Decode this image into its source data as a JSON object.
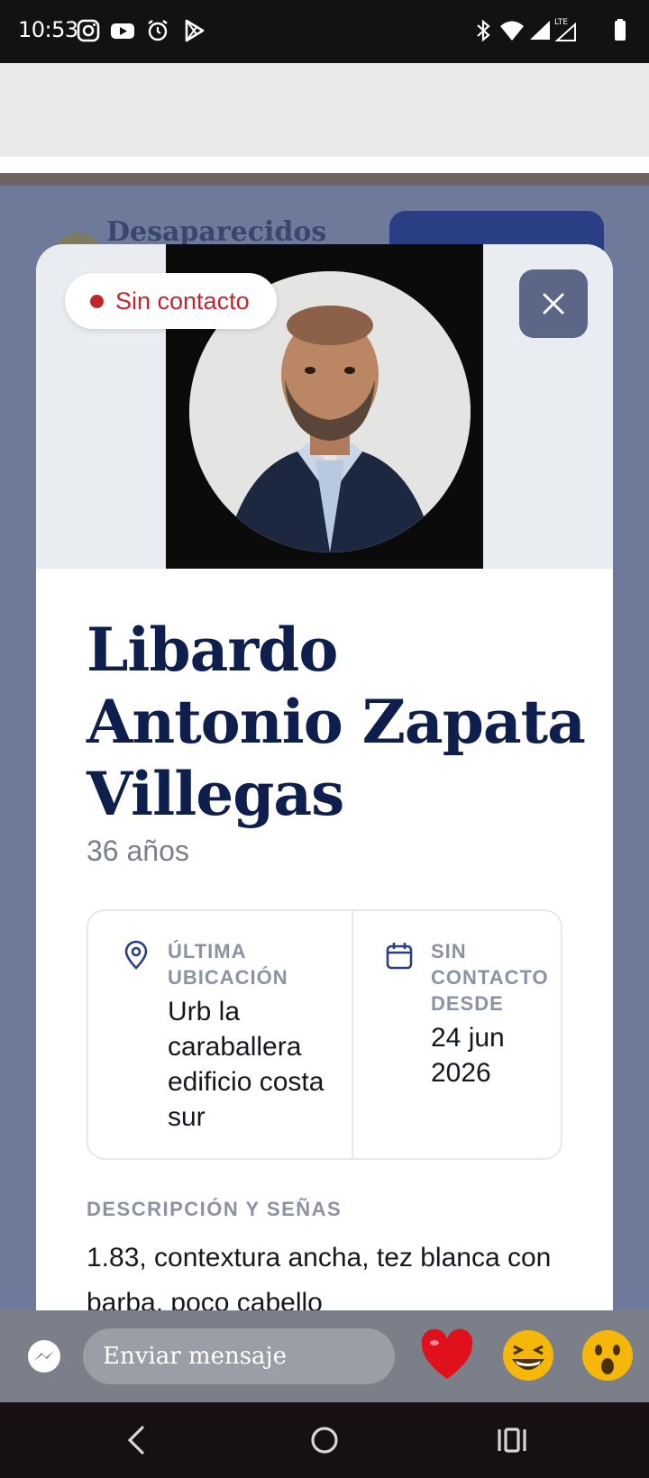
{
  "status_bar": {
    "time": "10:53",
    "left_icons": [
      "instagram-icon",
      "youtube-icon",
      "alarm-icon",
      "play-store-icon"
    ],
    "right_icons": [
      "bluetooth-icon",
      "wifi-icon",
      "signal-icon",
      "lte-signal-icon",
      "battery-icon"
    ],
    "lte_label": "LTE"
  },
  "background_page": {
    "title": "Desaparecidos"
  },
  "modal": {
    "status_badge": "Sin contacto",
    "status_color": "#c0262d",
    "name": "Libardo Antonio Zapata Villegas",
    "age": "36 años",
    "last_location": {
      "label": "ÚLTIMA UBICACIÓN",
      "value": "Urb la caraballera edificio costa sur",
      "icon": "map-pin-icon"
    },
    "no_contact_since": {
      "label": "SIN CONTACTO DESDE",
      "value": "24 jun 2026",
      "icon": "calendar-icon"
    },
    "description": {
      "label": "DESCRIPCIÓN Y SEÑAS",
      "text": "1.83, contextura ancha, tez blanca con barba, poco cabello"
    },
    "accent_color": "#0f1f4d"
  },
  "messenger": {
    "placeholder": "Enviar mensaje",
    "reactions": [
      "heart-icon",
      "laughing-emoji-icon",
      "surprised-emoji-icon"
    ]
  },
  "nav": {
    "buttons": [
      "back-icon",
      "home-icon",
      "recents-icon"
    ]
  }
}
